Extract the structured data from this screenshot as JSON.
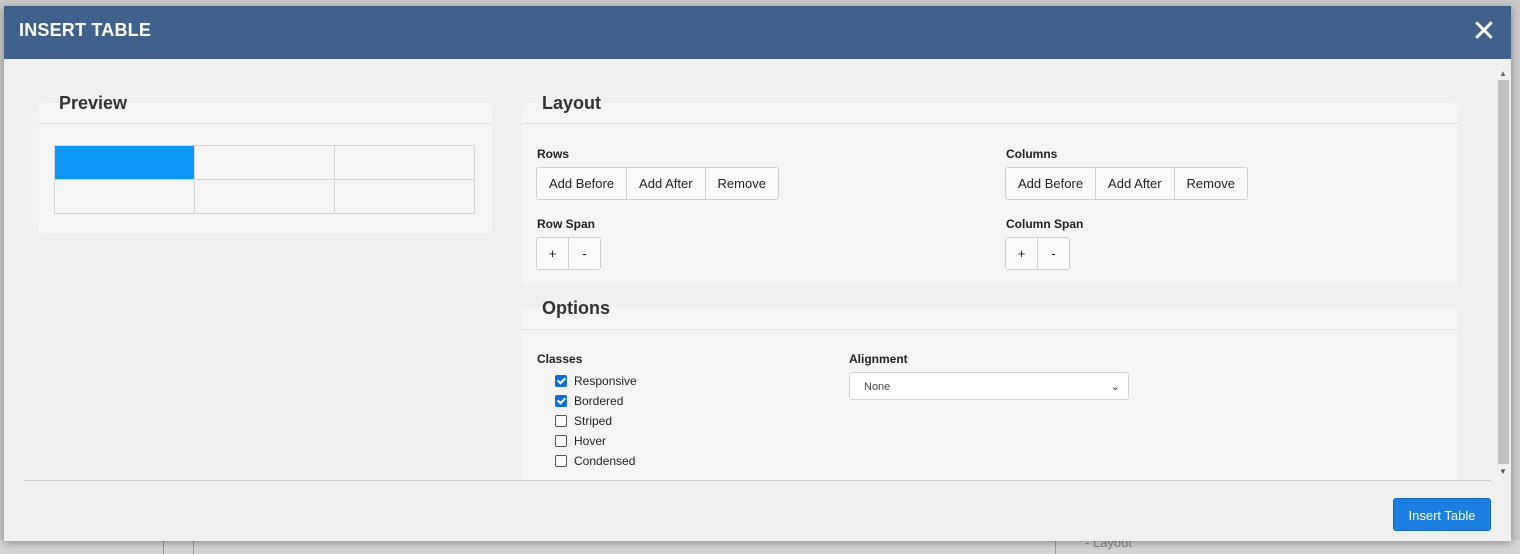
{
  "modal": {
    "title": "INSERT TABLE",
    "close_icon": "close-icon"
  },
  "preview": {
    "title": "Preview",
    "rows": 2,
    "cols": 3,
    "active_cell": [
      0,
      0
    ],
    "active_color": "#0a97f5"
  },
  "layout": {
    "title": "Layout",
    "rows": {
      "label": "Rows",
      "buttons": [
        "Add Before",
        "Add After",
        "Remove"
      ]
    },
    "columns": {
      "label": "Columns",
      "buttons": [
        "Add Before",
        "Add After",
        "Remove"
      ]
    },
    "row_span": {
      "label": "Row Span",
      "buttons": [
        "+",
        "-"
      ]
    },
    "column_span": {
      "label": "Column Span",
      "buttons": [
        "+",
        "-"
      ]
    }
  },
  "options": {
    "title": "Options",
    "classes_label": "Classes",
    "classes": [
      {
        "label": "Responsive",
        "checked": true
      },
      {
        "label": "Bordered",
        "checked": true
      },
      {
        "label": "Striped",
        "checked": false
      },
      {
        "label": "Hover",
        "checked": false
      },
      {
        "label": "Condensed",
        "checked": false
      }
    ],
    "alignment_label": "Alignment",
    "alignment_value": "None"
  },
  "footer": {
    "insert_button": "Insert Table"
  },
  "background": {
    "partial_text": "- Layout"
  },
  "colors": {
    "header": "#3e628c",
    "primary_button": "#1a7fde"
  }
}
